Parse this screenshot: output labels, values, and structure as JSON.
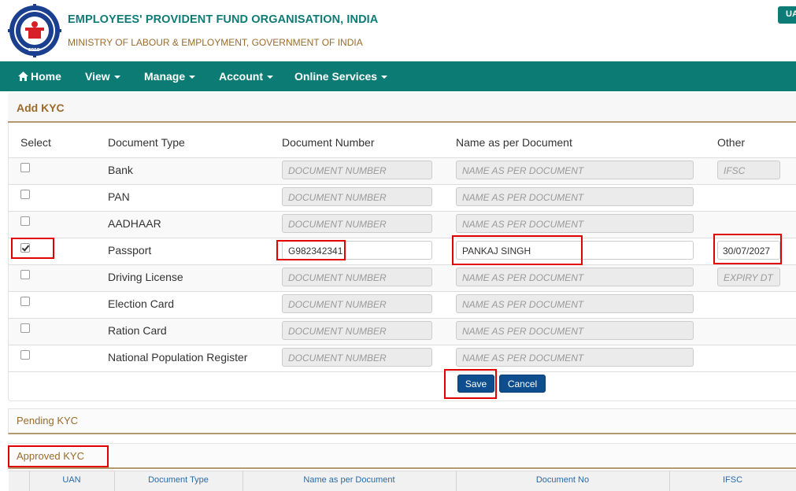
{
  "header": {
    "org_name": "EMPLOYEES' PROVIDENT FUND ORGANISATION, INDIA",
    "ministry": "MINISTRY OF LABOUR & EMPLOYMENT, GOVERNMENT OF INDIA",
    "uan_badge": "UA"
  },
  "nav": {
    "home": "Home",
    "view": "View",
    "manage": "Manage",
    "account": "Account",
    "online_services": "Online Services"
  },
  "add_kyc": {
    "title": "Add KYC",
    "columns": {
      "select": "Select",
      "document_type": "Document Type",
      "document_number": "Document Number",
      "name_as_per_document": "Name as per Document",
      "other": "Other"
    },
    "rows": [
      {
        "type": "Bank",
        "checked": false,
        "number_placeholder": "DOCUMENT NUMBER",
        "number_value": "",
        "name_placeholder": "NAME AS PER DOCUMENT",
        "name_value": "",
        "other_placeholder": "IFSC",
        "other_value": ""
      },
      {
        "type": "PAN",
        "checked": false,
        "number_placeholder": "DOCUMENT NUMBER",
        "number_value": "",
        "name_placeholder": "NAME AS PER DOCUMENT",
        "name_value": ""
      },
      {
        "type": "AADHAAR",
        "checked": false,
        "number_placeholder": "DOCUMENT NUMBER",
        "number_value": "",
        "name_placeholder": "NAME AS PER DOCUMENT",
        "name_value": ""
      },
      {
        "type": "Passport",
        "checked": true,
        "number_placeholder": "DOCUMENT NUMBER",
        "number_value": "G982342341",
        "name_placeholder": "NAME AS PER DOCUMENT",
        "name_value": "PANKAJ SINGH",
        "other_placeholder": "EXPIRY DT",
        "other_value": "30/07/2027"
      },
      {
        "type": "Driving License",
        "checked": false,
        "number_placeholder": "DOCUMENT NUMBER",
        "number_value": "",
        "name_placeholder": "NAME AS PER DOCUMENT",
        "name_value": "",
        "other_placeholder": "EXPIRY DT",
        "other_value": ""
      },
      {
        "type": "Election Card",
        "checked": false,
        "number_placeholder": "DOCUMENT NUMBER",
        "number_value": "",
        "name_placeholder": "NAME AS PER DOCUMENT",
        "name_value": ""
      },
      {
        "type": "Ration Card",
        "checked": false,
        "number_placeholder": "DOCUMENT NUMBER",
        "number_value": "",
        "name_placeholder": "NAME AS PER DOCUMENT",
        "name_value": ""
      },
      {
        "type": "National Population Register",
        "checked": false,
        "number_placeholder": "DOCUMENT NUMBER",
        "number_value": "",
        "name_placeholder": "NAME AS PER DOCUMENT",
        "name_value": ""
      }
    ],
    "save_label": "Save",
    "cancel_label": "Cancel"
  },
  "pending_kyc": {
    "title": "Pending KYC"
  },
  "approved_kyc": {
    "title": "Approved KYC",
    "columns": {
      "uan": "UAN",
      "document_type": "Document Type",
      "name_as_per_document": "Name as per Document",
      "document_no": "Document No",
      "ifsc": "IFSC"
    }
  },
  "colors": {
    "brand_teal": "#0b7b74",
    "brown_accent": "#9a6b2c",
    "button_blue": "#0e4e8e",
    "highlight_red": "#e00000"
  },
  "icons": [
    "epfo-logo",
    "home-icon",
    "chevron-down-icon",
    "checkbox"
  ]
}
